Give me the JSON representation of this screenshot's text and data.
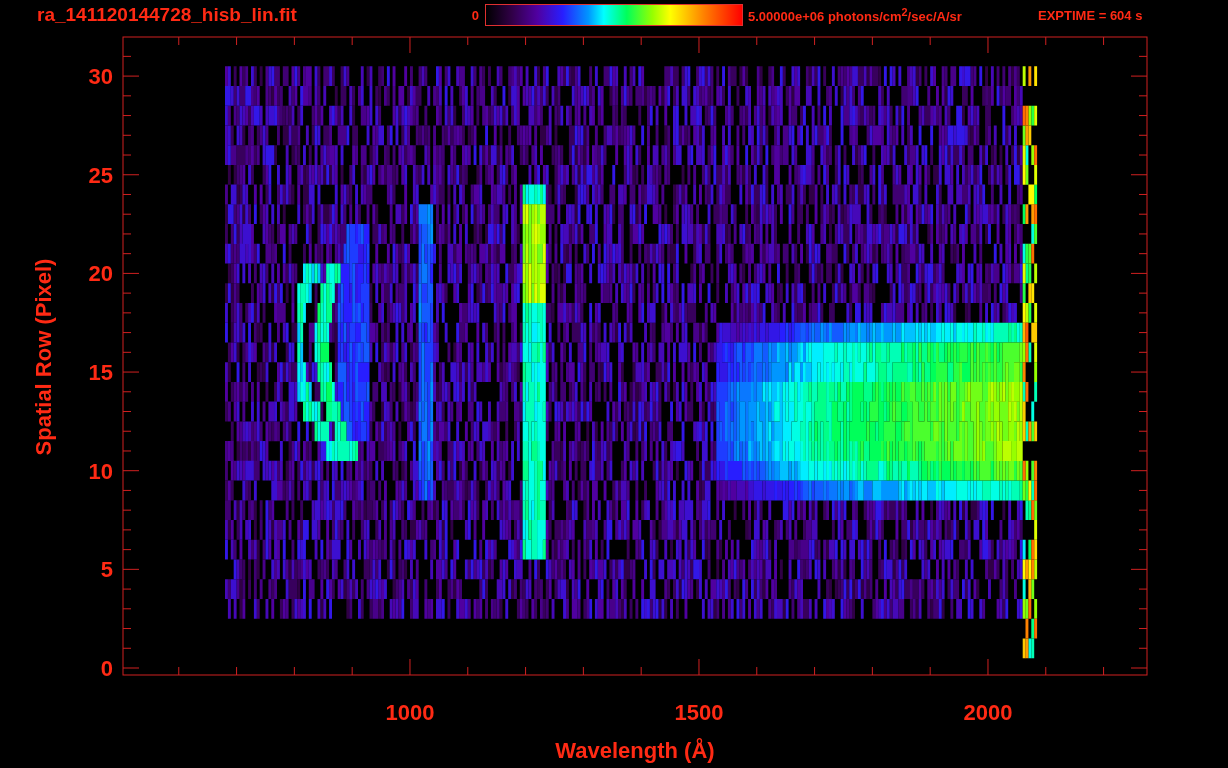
{
  "header": {
    "title": "ra_141120144728_hisb_lin.fit",
    "colorbar": {
      "min_label": "0",
      "max_label": "5.00000e+06 photons/cm$^{2}$/sec/A/sr"
    },
    "exptime": "EXPTIME = 604 s"
  },
  "plot": {
    "ylabel": "Spatial Row (Pixel)",
    "xlabel": "Wavelength (Å)",
    "yticks": [
      "30",
      "25",
      "20",
      "15",
      "10",
      "5",
      "0"
    ],
    "xticks": [
      "1000",
      "1500",
      "2000"
    ]
  }
}
